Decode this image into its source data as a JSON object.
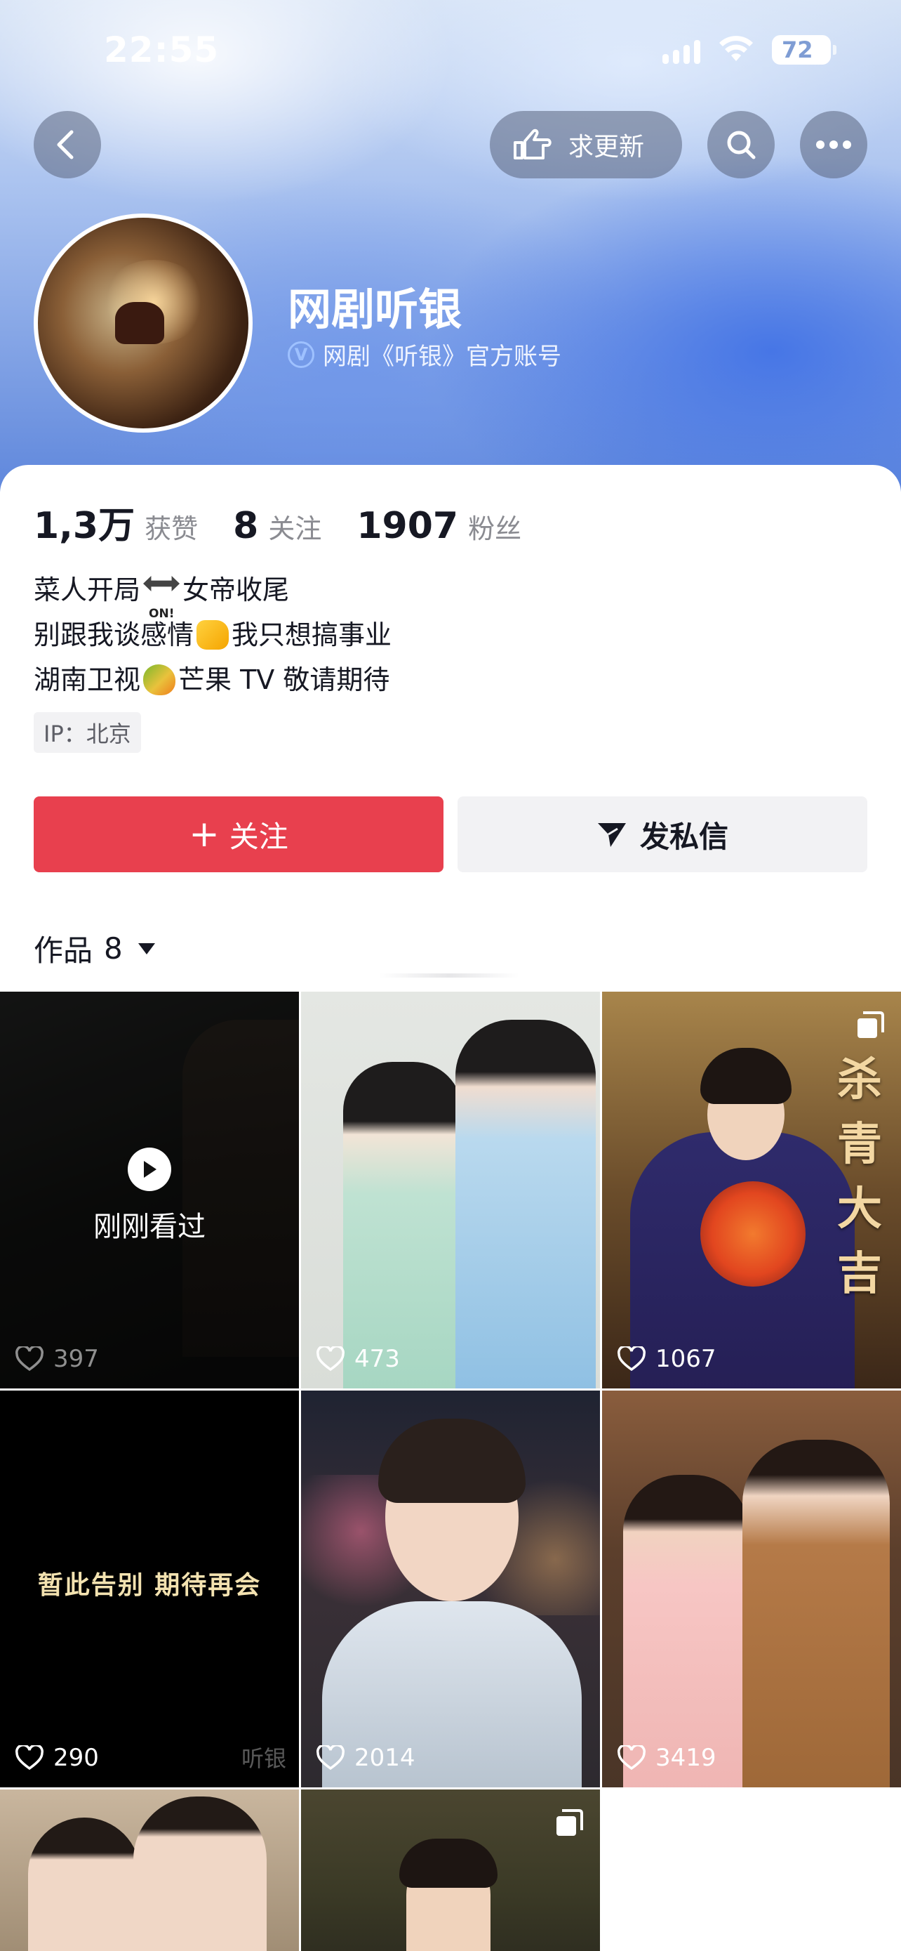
{
  "status_bar": {
    "time": "22:55",
    "battery": "72"
  },
  "nav": {
    "update_label": "求更新"
  },
  "profile": {
    "name": "网剧听银",
    "verified_text": "网剧《听银》官方账号",
    "verified_badge": "V"
  },
  "stats": [
    {
      "value": "1,3万",
      "label": "获赞"
    },
    {
      "value": "8",
      "label": "关注"
    },
    {
      "value": "1907",
      "label": "粉丝"
    }
  ],
  "bio": {
    "line1_a": "菜人开局",
    "line1_emoji_text": "ON!",
    "line1_b": "女帝收尾",
    "line2_a": "别跟我谈感情",
    "line2_b": "我只想搞事业",
    "line3_a": "湖南卫视",
    "line3_b": "芒果 TV 敬请期待"
  },
  "ip": "IP：北京",
  "actions": {
    "follow": "关注",
    "follow_plus": "+",
    "message": "发私信"
  },
  "works": {
    "label": "作品",
    "count": "8"
  },
  "videos": [
    {
      "likes": "397",
      "overlay": "刚刚看过"
    },
    {
      "likes": "473"
    },
    {
      "likes": "1067",
      "calligraphy": "杀青大吉"
    },
    {
      "likes": "290",
      "caption": "暂此告别 期待再会",
      "signature": "听银"
    },
    {
      "likes": "2014"
    },
    {
      "likes": "3419"
    },
    {},
    {},
    {}
  ],
  "colors": {
    "follow": "#e8404e",
    "secondary_button": "#f2f2f4",
    "text": "#161823",
    "muted": "#8a8b91"
  },
  "icons": [
    "back-icon",
    "hand-pointer-icon",
    "search-icon",
    "more-icon",
    "plus-icon",
    "paper-plane-icon",
    "heart-icon",
    "play-icon",
    "multi-image-icon"
  ]
}
